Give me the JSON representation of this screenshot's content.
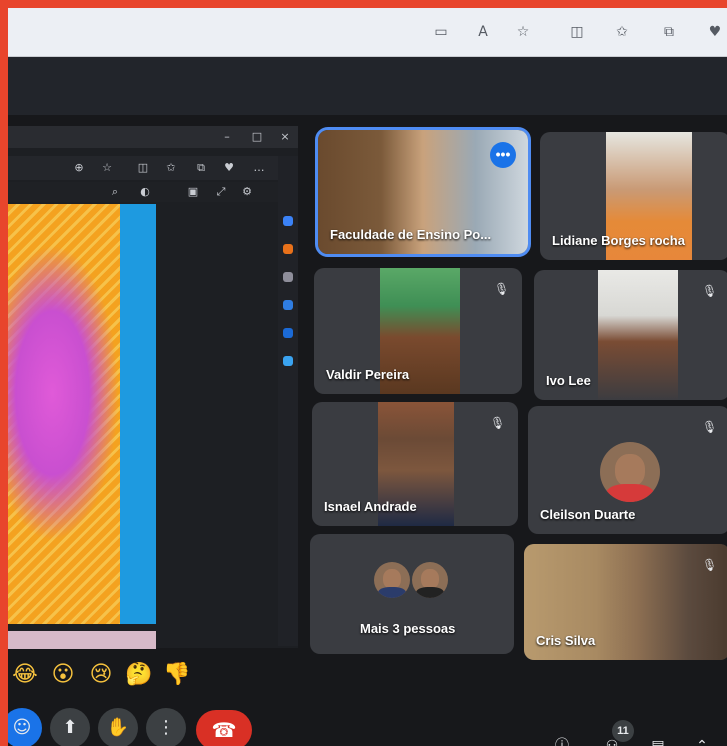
{
  "browser": {
    "icons": [
      "camera-icon",
      "read-aloud-icon",
      "favorite-star-icon",
      "split-screen-icon",
      "favorites-icon",
      "collections-icon",
      "heart-icon"
    ]
  },
  "participants": [
    {
      "name": "Faculdade de Ensino Po...",
      "muted": false,
      "active": true,
      "more": "•••"
    },
    {
      "name": "Lidiane Borges rocha",
      "muted": false
    },
    {
      "name": "Valdir Pereira",
      "muted": true
    },
    {
      "name": "Ivo Lee",
      "muted": true
    },
    {
      "name": "Isnael Andrade",
      "muted": true
    },
    {
      "name": "Cleilson Duarte",
      "muted": true
    },
    {
      "name": "Mais 3 pessoas",
      "muted": false
    },
    {
      "name": "Cris Silva",
      "muted": true
    }
  ],
  "reactions": [
    "😂",
    "😮",
    "😢",
    "🤔",
    "👎"
  ],
  "controls": {
    "participants_count": "11",
    "mic_off_glyph": "🎙",
    "more_glyph": "⋮",
    "hand_glyph": "✋",
    "present_glyph": "⬆",
    "reactions_glyph": "☺",
    "end_call_glyph": "☎"
  },
  "colors": {
    "frame": "#e8452c",
    "active_outline": "#4f8cf2",
    "end_call": "#d93025",
    "tile_bg": "#3a3c41"
  }
}
